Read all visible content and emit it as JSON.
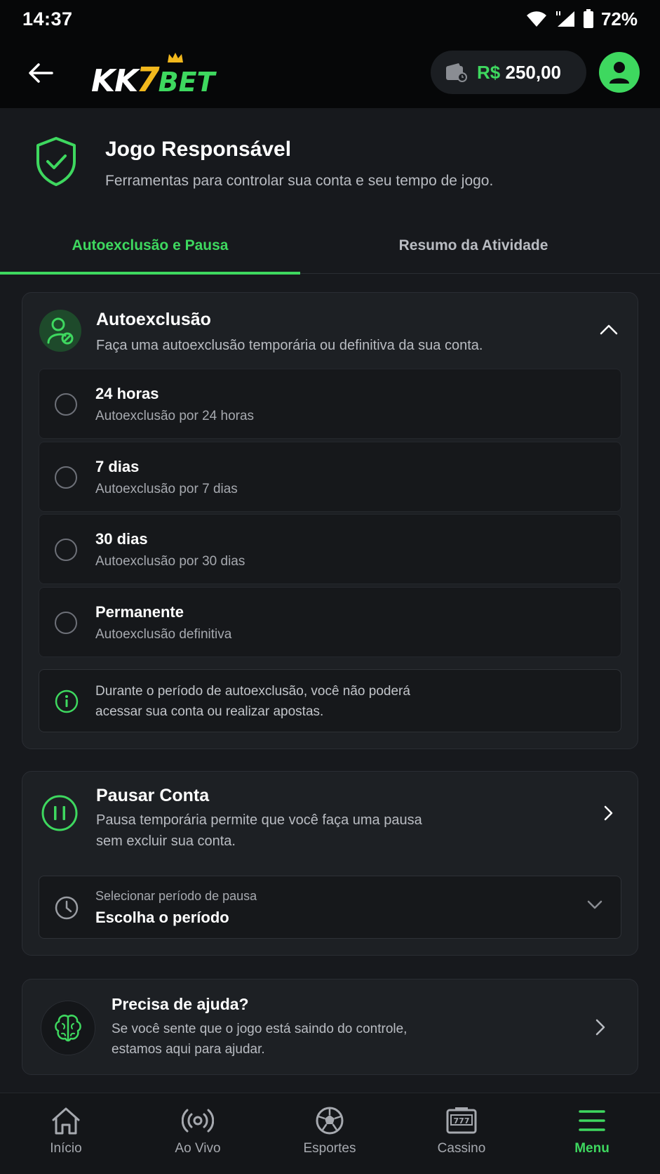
{
  "status_bar": {
    "time": "14:37",
    "battery": "72%"
  },
  "header": {
    "logo_kk": "KK",
    "logo_7": "7",
    "logo_bet": "BET",
    "balance_currency": "R$",
    "balance_value": "250,00"
  },
  "page": {
    "title": "Jogo Responsável",
    "subtitle": "Ferramentas para controlar sua conta e seu tempo de jogo."
  },
  "tabs": [
    {
      "label": "Autoexclusão e Pausa",
      "active": true
    },
    {
      "label": "Resumo da Atividade",
      "active": false
    }
  ],
  "self_exclusion": {
    "title": "Autoexclusão",
    "subtitle": "Faça uma autoexclusão temporária ou definitiva da sua conta.",
    "options": [
      {
        "title": "24 horas",
        "subtitle": "Autoexclusão por 24 horas"
      },
      {
        "title": "7 dias",
        "subtitle": "Autoexclusão por 7 dias"
      },
      {
        "title": "30 dias",
        "subtitle": "Autoexclusão por 30 dias"
      },
      {
        "title": "Permanente",
        "subtitle": "Autoexclusão definitiva"
      }
    ],
    "info_line1": "Durante o período de autoexclusão, você não poderá",
    "info_line2": "acessar sua conta ou realizar apostas."
  },
  "pause": {
    "title": "Pausar Conta",
    "subtitle_line1": "Pausa temporária permite que você faça uma pausa",
    "subtitle_line2": "sem excluir sua conta.",
    "select_label": "Selecionar período de pausa",
    "select_value": "Escolha o período"
  },
  "help": {
    "title": "Precisa de ajuda?",
    "subtitle_line1": "Se você sente que o jogo está saindo do controle,",
    "subtitle_line2": "estamos aqui para ajudar."
  },
  "bottom_nav": [
    {
      "label": "Início",
      "icon": "home-icon"
    },
    {
      "label": "Ao Vivo",
      "icon": "live-icon"
    },
    {
      "label": "Esportes",
      "icon": "soccer-ball-icon"
    },
    {
      "label": "Cassino",
      "icon": "slot-machine-icon"
    },
    {
      "label": "Menu",
      "icon": "menu-icon",
      "active": true
    }
  ],
  "colors": {
    "accent": "#3ed85f",
    "gold": "#f2b81d",
    "background": "#17191d",
    "card": "#1d2024"
  }
}
